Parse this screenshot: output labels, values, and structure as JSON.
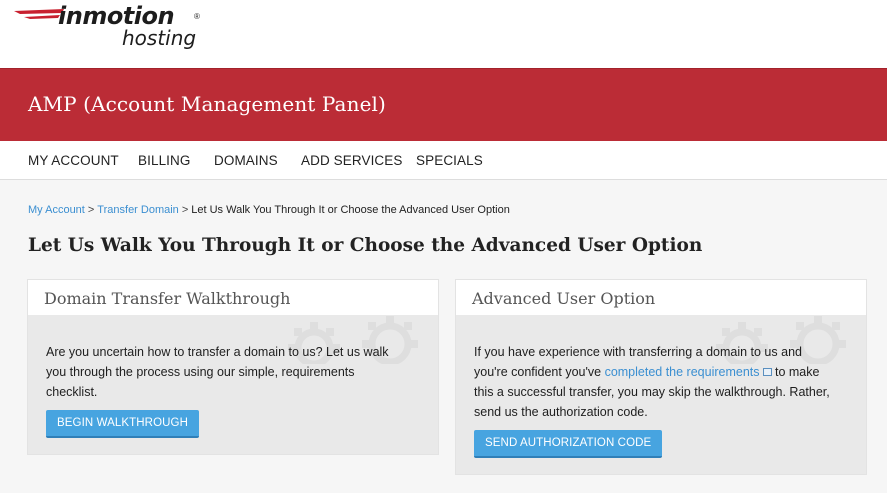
{
  "logo": {
    "brand": "inmotion",
    "reg": "®",
    "sub": "hosting"
  },
  "banner": {
    "title": "AMP (Account Management Panel)"
  },
  "nav": {
    "items": [
      {
        "label": "MY ACCOUNT"
      },
      {
        "label": "BILLING"
      },
      {
        "label": "DOMAINS"
      },
      {
        "label": "ADD SERVICES"
      },
      {
        "label": "SPECIALS"
      }
    ]
  },
  "breadcrumb": {
    "items": [
      "My Account",
      "Transfer Domain"
    ],
    "separator": ">",
    "current": "Let Us Walk You Through It or Choose the Advanced User Option"
  },
  "page": {
    "title": "Let Us Walk You Through It or Choose the Advanced User Option"
  },
  "cards": [
    {
      "title": "Domain Transfer Walkthrough",
      "lines": [
        "Are you uncertain how to transfer a domain to us? Let us walk",
        "you through the process using our simple, requirements",
        "checklist."
      ],
      "button": "BEGIN WALKTHROUGH"
    },
    {
      "title": "Advanced User Option",
      "line1": "If you have experience with transferring a domain to us and",
      "line2_pre": "you're confident you've ",
      "line2_link": "completed the requirements",
      "line2_post": " to make",
      "line3": "this a successful transfer, you may skip the walkthrough. Rather,",
      "line4": "send us the authorization code.",
      "button": "SEND AUTHORIZATION CODE"
    }
  ],
  "colors": {
    "brand_red": "#bb2c36",
    "link_blue": "#3b8fd1",
    "button_blue": "#47a4e0"
  },
  "icons": [
    "logo-swoosh-icon",
    "gears-watermark-icon",
    "external-link-icon"
  ]
}
